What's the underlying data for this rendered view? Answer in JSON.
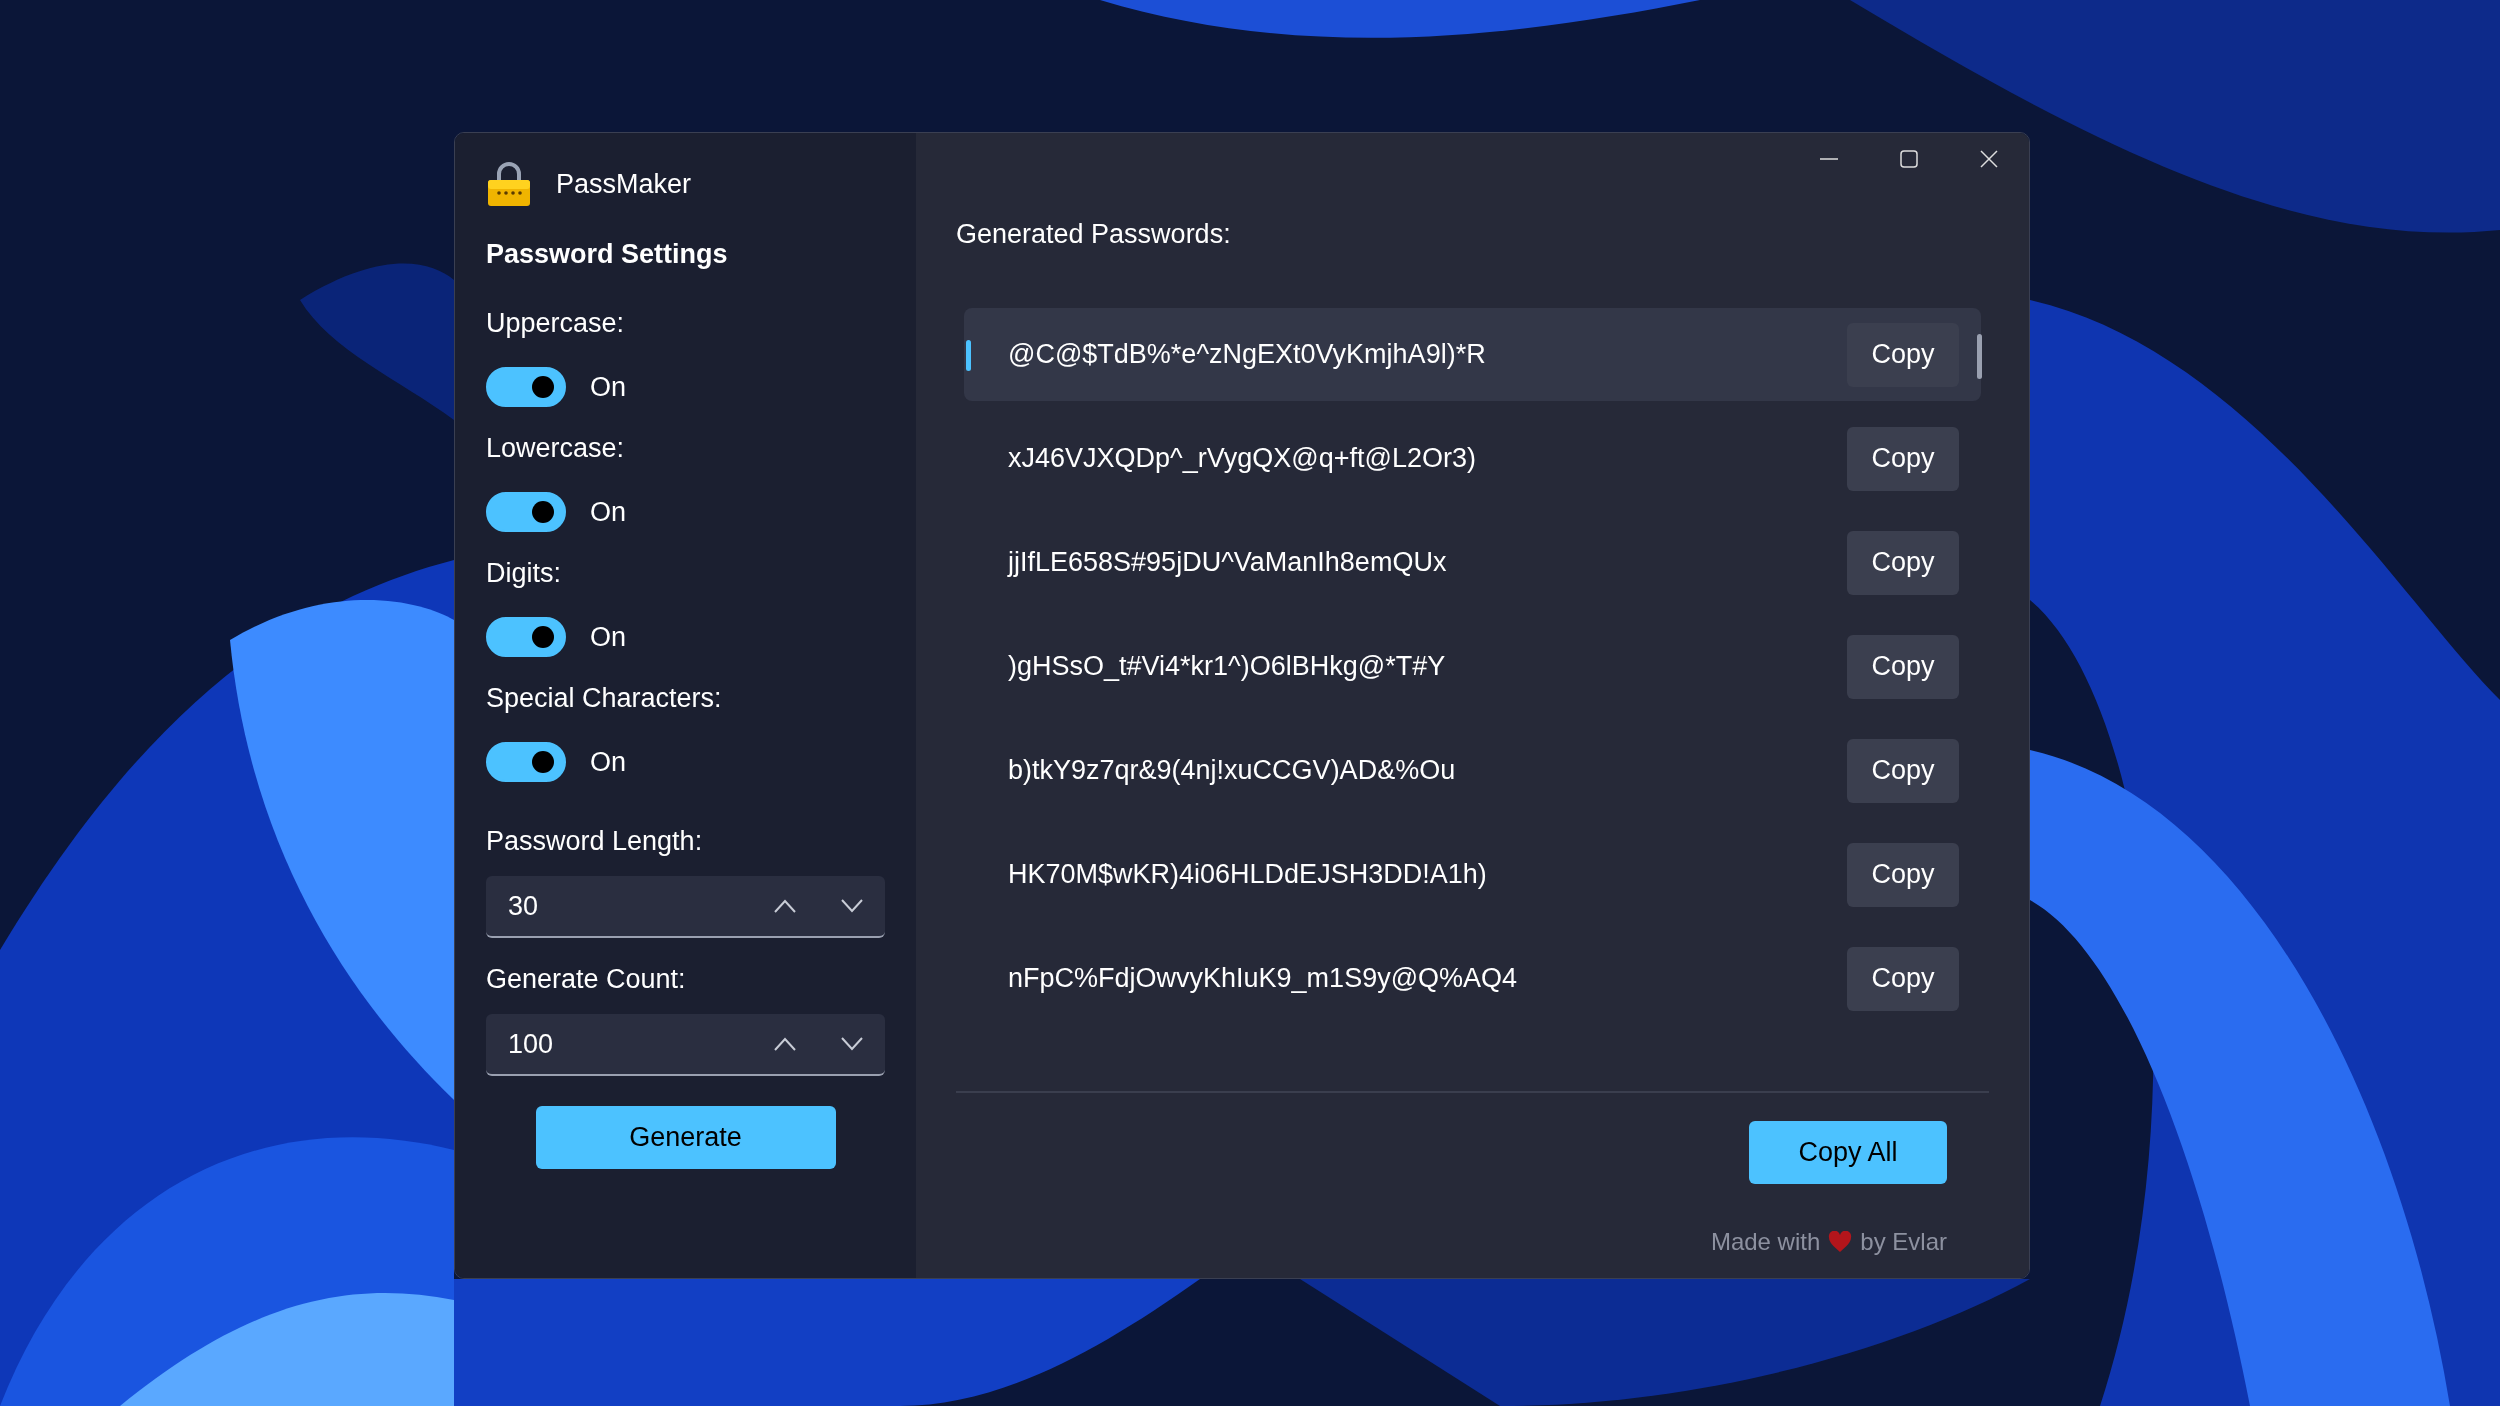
{
  "window": {
    "title": "PassMaker"
  },
  "settings": {
    "heading": "Password Settings",
    "toggles": [
      {
        "label": "Uppercase:",
        "on": true,
        "state_text": "On"
      },
      {
        "label": "Lowercase:",
        "on": true,
        "state_text": "On"
      },
      {
        "label": "Digits:",
        "on": true,
        "state_text": "On"
      },
      {
        "label": "Special Characters:",
        "on": true,
        "state_text": "On"
      }
    ],
    "spinners": [
      {
        "label": "Password Length:",
        "value": "30"
      },
      {
        "label": "Generate Count:",
        "value": "100"
      }
    ],
    "generate_button": "Generate"
  },
  "passwords": {
    "heading": "Generated Passwords:",
    "items": [
      {
        "text": "@C@$TdB%*e^zNgEXt0VyKmjhA9l)*R",
        "selected": true,
        "copy_label": "Copy"
      },
      {
        "text": "xJ46VJXQDp^_rVygQX@q+ft@L2Or3)",
        "selected": false,
        "copy_label": "Copy"
      },
      {
        "text": "jjIfLE658S#95jDU^VaManIh8emQUx",
        "selected": false,
        "copy_label": "Copy"
      },
      {
        "text": ")gHSsO_t#Vi4*kr1^)O6lBHkg@*T#Y",
        "selected": false,
        "copy_label": "Copy"
      },
      {
        "text": "b)tkY9z7qr&9(4nj!xuCCGV)AD&%Ou",
        "selected": false,
        "copy_label": "Copy"
      },
      {
        "text": "HK70M$wKR)4i06HLDdEJSH3DD!A1h)",
        "selected": false,
        "copy_label": "Copy"
      },
      {
        "text": "nFpC%FdjOwvyKhIuK9_m1S9y@Q%AQ4",
        "selected": false,
        "copy_label": "Copy"
      }
    ]
  },
  "copy_all_button": "Copy All",
  "footer": {
    "before": "Made with",
    "after": "by Evlar"
  }
}
